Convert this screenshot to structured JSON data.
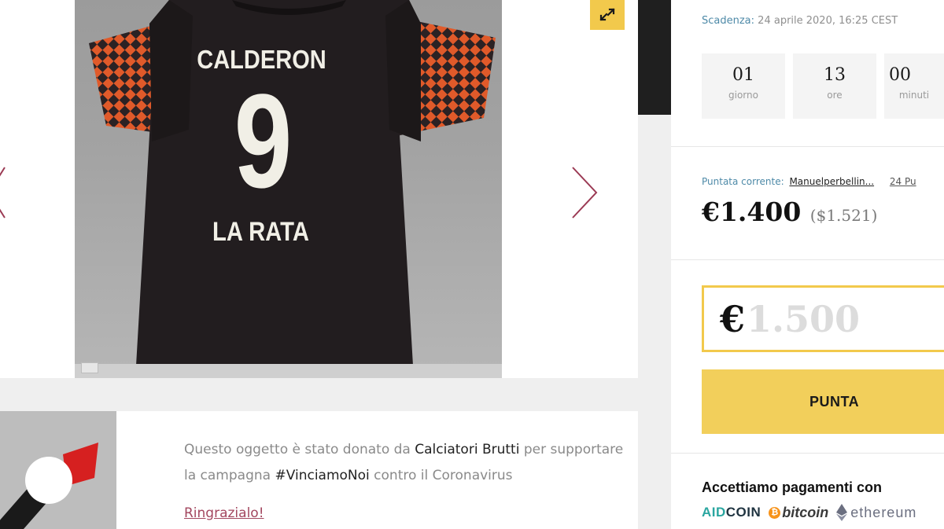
{
  "jersey": {
    "name": "CALDERON",
    "number": "9",
    "nickname": "LA RATA"
  },
  "gallery": {
    "icons": {
      "expand": "expand-icon",
      "prev": "chevron-left-icon",
      "next": "chevron-right-icon"
    },
    "accent_color": "#f2c94c"
  },
  "donor": {
    "text_before": "Questo oggetto è stato donato da ",
    "donor_name": "Calciatori Brutti",
    "text_middle_1": " per supportare la campagna ",
    "campaign": "#VinciamoNoi",
    "text_after": " contro il Coronavirus",
    "thanks_link": "Ringrazialo!"
  },
  "auction": {
    "deadline_label": "Scadenza:",
    "deadline_value": "24 aprile 2020, 16:25 CEST",
    "countdown": [
      {
        "value": "01",
        "label": "giorno"
      },
      {
        "value": "13",
        "label": "ore"
      },
      {
        "value": "00",
        "label": "minuti"
      }
    ],
    "current_bid_label": "Puntata corrente:",
    "current_bidder": "Manuelperbellin...",
    "bid_count": "24 Pu",
    "current_price": "€1.400",
    "current_price_usd": "($1.521)",
    "bid_currency_symbol": "€",
    "bid_placeholder": "1.500",
    "bid_button_label": "PUNTA"
  },
  "payments": {
    "title": "Accettiamo pagamenti con",
    "aidcoin_aid": "AID",
    "aidcoin_coin": "COIN",
    "bitcoin": "bitcoin",
    "ethereum": "ethereum",
    "colors": {
      "aidcoin": "#2aa6a0",
      "bitcoin": "#f7931a",
      "ethereum": "#6b6f80"
    }
  },
  "colors": {
    "accent_yellow": "#f2c94c",
    "link": "#a3475f",
    "meta_blue": "#4e8aa8"
  }
}
